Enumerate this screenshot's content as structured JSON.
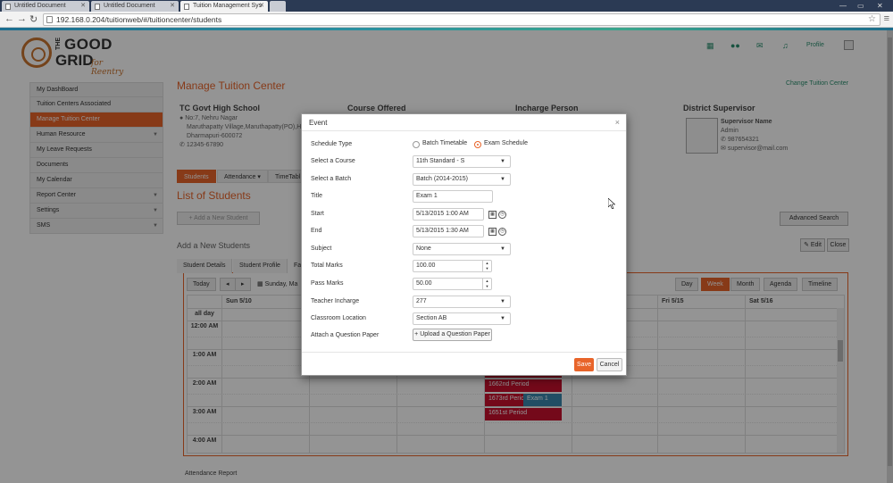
{
  "browser": {
    "tabs": [
      {
        "title": "Untitled Document"
      },
      {
        "title": "Untitled Document"
      },
      {
        "title": "Tuition Management Sys"
      }
    ],
    "url": "192.168.0.204/tuitionweb/#/tuitioncenter/students"
  },
  "header": {
    "logo_line1": "THE",
    "logo_line2": "GOOD",
    "logo_line3": "GRID",
    "logo_tagline": "for Reentry",
    "icons": [
      "grid-icon",
      "users-icon",
      "mail-icon",
      "bell-icon"
    ],
    "profile_label": "Profile"
  },
  "sidebar": {
    "items": [
      {
        "label": "My DashBoard",
        "has_caret": false
      },
      {
        "label": "Tuition Centers Associated",
        "has_caret": false
      },
      {
        "label": "Manage Tuition Center",
        "has_caret": false
      },
      {
        "label": "Human Resource",
        "has_caret": true
      },
      {
        "label": "My Leave Requests",
        "has_caret": false
      },
      {
        "label": "Documents",
        "has_caret": false
      },
      {
        "label": "My Calendar",
        "has_caret": false
      },
      {
        "label": "Report Center",
        "has_caret": true
      },
      {
        "label": "Settings",
        "has_caret": true
      },
      {
        "label": "SMS",
        "has_caret": true
      }
    ]
  },
  "main": {
    "title": "Manage Tuition Center",
    "change_link": "Change Tuition Center",
    "school": {
      "name": "TC Govt High School",
      "addr1": "No:7, Nehru Nagar",
      "addr2": "Maruthapatty Village,Maruthapatty(PO),H",
      "addr3": "Dharmapuri-600072",
      "phone": "12345-67890"
    },
    "course_heading": "Course Offered",
    "incharge_heading": "Incharge Person",
    "supervisor": {
      "heading": "District Supervisor",
      "name": "Supervisor Name",
      "role": "Admin",
      "phone": "987654321",
      "email": "supervisor@mail.com"
    },
    "subtabs": [
      "Students",
      "Attendance",
      "TimeTabl"
    ],
    "list_title": "List of Students",
    "add_new_label": "+ Add a New Student",
    "advanced_search": "Advanced Search",
    "add_students_title": "Add a New Students",
    "edit_label": "Edit",
    "close_label": "Close",
    "student_tabs": [
      "Student Details",
      "Student Profile",
      "Fa"
    ],
    "attendance_report": "Attendance Report"
  },
  "calendar": {
    "today": "Today",
    "prev": "◂",
    "next": "▸",
    "range_label": "Sunday, Ma",
    "views": [
      "Day",
      "Week",
      "Month",
      "Agenda",
      "Timeline"
    ],
    "active_view": "Week",
    "days": [
      "Sun 5/10",
      "Fri 5/15",
      "Sat 5/16"
    ],
    "allday": "all day",
    "times": [
      "12:00 AM",
      "1:00 AM",
      "2:00 AM",
      "3:00 AM",
      "4:00 AM"
    ],
    "events": [
      {
        "title": "1662nd Period"
      },
      {
        "title": "1673rd Period"
      },
      {
        "title": "Exam 1"
      },
      {
        "title": "1651st Period"
      }
    ]
  },
  "modal": {
    "title": "Event",
    "close": "×",
    "schedule_type_label": "Schedule Type",
    "radio_batch": "Batch Timetable",
    "radio_exam": "Exam Schedule",
    "course_label": "Select a Course",
    "course_value": "11th Standard - S",
    "batch_label": "Select a Batch",
    "batch_value": "Batch (2014-2015)",
    "title_label": "Title",
    "title_value": "Exam 1",
    "start_label": "Start",
    "start_value": "5/13/2015 1:00 AM",
    "end_label": "End",
    "end_value": "5/13/2015 1:30 AM",
    "subject_label": "Subject",
    "subject_value": "None",
    "total_marks_label": "Total Marks",
    "total_marks_value": "100.00",
    "pass_marks_label": "Pass Marks",
    "pass_marks_value": "50.00",
    "teacher_label": "Teacher Incharge",
    "teacher_value": "277",
    "classroom_label": "Classroom Location",
    "classroom_value": "Section AB",
    "attach_label": "Attach a Question Paper",
    "upload_label": "+ Upload a Question Paper",
    "save_label": "Save",
    "cancel_label": "Cancel"
  },
  "colors": {
    "accent": "#e8642a",
    "event_red": "#c8102e",
    "event_blue": "#3a87ad",
    "header_teal": "#2a8f6f"
  }
}
